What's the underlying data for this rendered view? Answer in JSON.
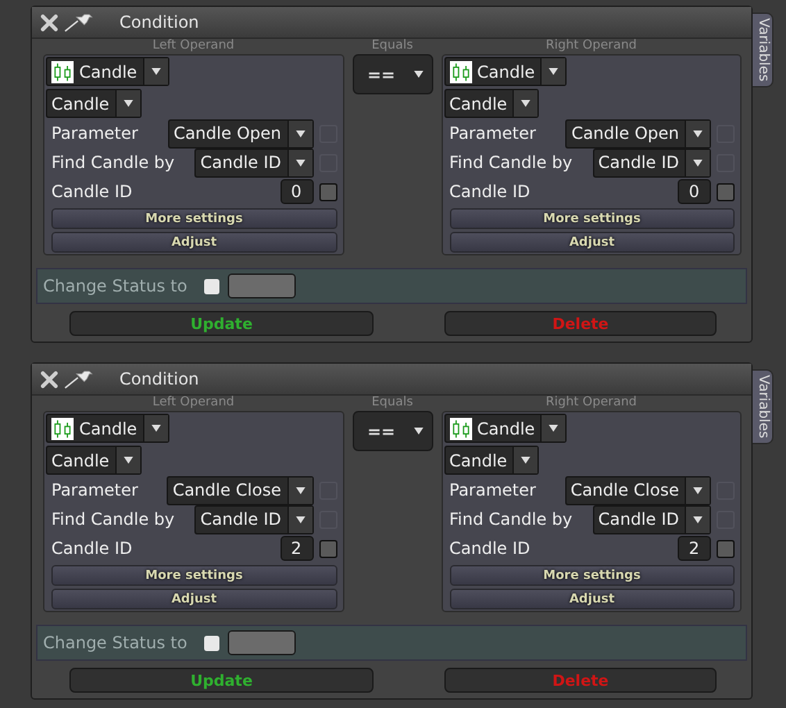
{
  "conditions": [
    {
      "title": "Condition",
      "side_tab": "Variables",
      "left": {
        "heading": "Left Operand",
        "source": "Candle",
        "type": "Candle",
        "rows": [
          {
            "kind": "select",
            "label": "Parameter",
            "value": "Candle Open",
            "checked": false,
            "disabled": true
          },
          {
            "kind": "select",
            "label": "Find Candle by",
            "value": "Candle ID",
            "checked": false,
            "disabled": true
          },
          {
            "kind": "number",
            "label": "Candle ID",
            "value": "0",
            "checked": false,
            "disabled": false
          }
        ],
        "buttons": [
          "More settings",
          "Adjust"
        ]
      },
      "equals": {
        "heading": "Equals",
        "value": "=="
      },
      "right": {
        "heading": "Right Operand",
        "source": "Candle",
        "type": "Candle",
        "rows": [
          {
            "kind": "select",
            "label": "Parameter",
            "value": "Candle Open",
            "checked": false,
            "disabled": true
          },
          {
            "kind": "select",
            "label": "Find Candle by",
            "value": "Candle ID",
            "checked": false,
            "disabled": true
          },
          {
            "kind": "number",
            "label": "Candle ID",
            "value": "0",
            "checked": false,
            "disabled": false
          }
        ],
        "buttons": [
          "More settings",
          "Adjust"
        ]
      },
      "change_status": {
        "label": "Change Status to",
        "checked": false
      },
      "actions": [
        {
          "kind": "update",
          "label": "Update"
        },
        {
          "kind": "delete",
          "label": "Delete"
        }
      ]
    },
    {
      "title": "Condition",
      "side_tab": "Variables",
      "left": {
        "heading": "Left Operand",
        "source": "Candle",
        "type": "Candle",
        "rows": [
          {
            "kind": "select",
            "label": "Parameter",
            "value": "Candle Close",
            "checked": false,
            "disabled": true
          },
          {
            "kind": "select",
            "label": "Find Candle by",
            "value": "Candle ID",
            "checked": false,
            "disabled": true
          },
          {
            "kind": "number",
            "label": "Candle ID",
            "value": "2",
            "checked": false,
            "disabled": false
          }
        ],
        "buttons": [
          "More settings",
          "Adjust"
        ]
      },
      "equals": {
        "heading": "Equals",
        "value": "=="
      },
      "right": {
        "heading": "Right Operand",
        "source": "Candle",
        "type": "Candle",
        "rows": [
          {
            "kind": "select",
            "label": "Parameter",
            "value": "Candle Close",
            "checked": false,
            "disabled": true
          },
          {
            "kind": "select",
            "label": "Find Candle by",
            "value": "Candle ID",
            "checked": false,
            "disabled": true
          },
          {
            "kind": "number",
            "label": "Candle ID",
            "value": "2",
            "checked": false,
            "disabled": false
          }
        ],
        "buttons": [
          "More settings",
          "Adjust"
        ]
      },
      "change_status": {
        "label": "Change Status to",
        "checked": false
      },
      "actions": [
        {
          "kind": "update",
          "label": "Update"
        },
        {
          "kind": "delete",
          "label": "Delete"
        }
      ]
    }
  ]
}
